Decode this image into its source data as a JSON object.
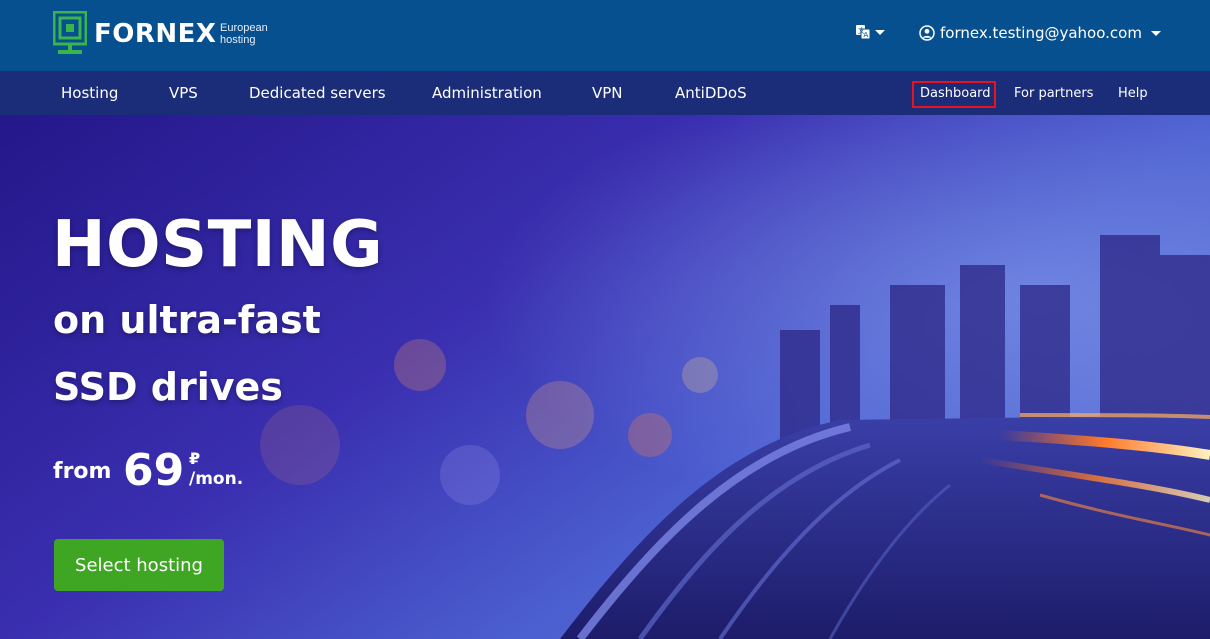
{
  "brand": {
    "name": "FORNEX",
    "tagline_line1": "European",
    "tagline_line2": "hosting",
    "logo_color": "#39b54a"
  },
  "header": {
    "language_icon": "translate-icon",
    "account_email": "fornex.testing@yahoo.com"
  },
  "nav": {
    "items": [
      {
        "label": "Hosting"
      },
      {
        "label": "VPS"
      },
      {
        "label": "Dedicated servers"
      },
      {
        "label": "Administration"
      },
      {
        "label": "VPN"
      },
      {
        "label": "AntiDDoS"
      }
    ],
    "right": [
      {
        "label": "Dashboard"
      },
      {
        "label": "For partners"
      },
      {
        "label": "Help"
      }
    ]
  },
  "hero": {
    "title": "HOSTING",
    "subtitle_line1": "on ultra-fast",
    "subtitle_line2": "SSD drives",
    "price_from": "from",
    "price_value": "69",
    "price_currency": "₽",
    "price_period": "/mon.",
    "cta_label": "Select hosting",
    "cta_color": "#3fa624"
  },
  "colors": {
    "topbar": "#07508f",
    "navbar": "#1b2c78",
    "highlight": "#e5141d"
  }
}
